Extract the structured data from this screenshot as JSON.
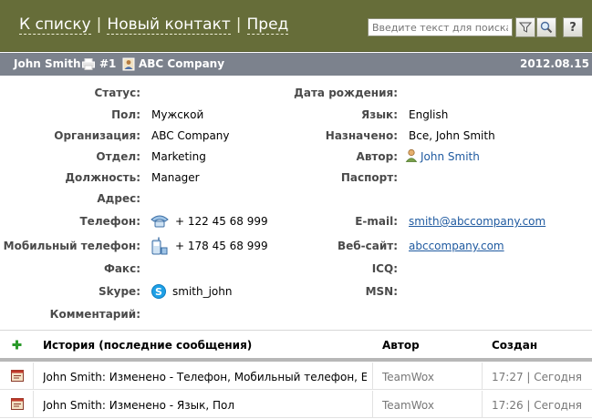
{
  "nav": {
    "back_to_list": "К списку",
    "sep": "|",
    "new_contact": "Новый контакт",
    "prev": "Пред"
  },
  "search": {
    "placeholder": "Введите текст для поиска"
  },
  "toolbar": {
    "help_label": "?"
  },
  "contact": {
    "name": "John Smith",
    "number": "#1",
    "company": "ABC Company",
    "date": "2012.08.15"
  },
  "left_fields": [
    {
      "label": "Статус:",
      "value": ""
    },
    {
      "label": "Пол:",
      "value": "Мужской"
    },
    {
      "label": "Организация:",
      "value": "ABC Company"
    },
    {
      "label": "Отдел:",
      "value": "Marketing"
    },
    {
      "label": "Должность:",
      "value": "Manager"
    },
    {
      "label": "Адрес:",
      "value": ""
    },
    {
      "label": "Телефон:",
      "value": "+ 122 45 68 999"
    },
    {
      "label": "Мобильный телефон:",
      "value": "+ 178 45 68 999"
    },
    {
      "label": "Факс:",
      "value": ""
    },
    {
      "label": "Skype:",
      "value": "smith_john"
    },
    {
      "label": "Комментарий:",
      "value": ""
    }
  ],
  "right_fields": [
    {
      "label": "Дата рождения:",
      "value": ""
    },
    {
      "label": "Язык:",
      "value": "English"
    },
    {
      "label": "Назначено:",
      "value": "Все, John Smith"
    },
    {
      "label": "Автор:",
      "value": "John Smith"
    },
    {
      "label": "Паспорт:",
      "value": ""
    },
    {
      "label": "E-mail:",
      "value": "smith@abccompany.com"
    },
    {
      "label": "Веб-сайт:",
      "value": "abccompany.com"
    },
    {
      "label": "ICQ:",
      "value": ""
    },
    {
      "label": "MSN:",
      "value": ""
    }
  ],
  "history": {
    "title": "История (последние сообщения)",
    "author_header": "Автор",
    "created_header": "Создан",
    "rows": [
      {
        "text": "John Smith: Изменено - Телефон, Мобильный телефон, E-...",
        "author": "TeamWox",
        "created": "17:27 | Сегодня"
      },
      {
        "text": "John Smith: Изменено - Язык, Пол",
        "author": "TeamWox",
        "created": "17:26 | Сегодня"
      }
    ]
  },
  "colors": {
    "topbar": "#666d39",
    "titlebar": "#7c828d",
    "link": "#1f5aa0"
  }
}
